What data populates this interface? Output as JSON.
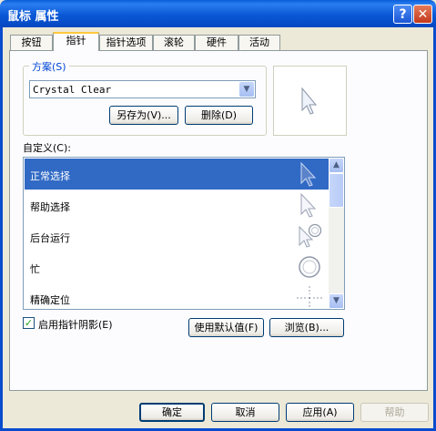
{
  "window": {
    "title": "鼠标 属性",
    "help": "?",
    "close": "✕"
  },
  "tabs": [
    {
      "label": "按钮"
    },
    {
      "label": "指针"
    },
    {
      "label": "指针选项"
    },
    {
      "label": "滚轮"
    },
    {
      "label": "硬件"
    },
    {
      "label": "活动"
    }
  ],
  "active_tab": "指针",
  "scheme": {
    "label": "方案(S)",
    "selected": "Crystal Clear",
    "save_as": "另存为(V)...",
    "delete": "删除(D)"
  },
  "customize": {
    "label": "自定义(C):",
    "items": [
      {
        "label": "正常选择",
        "icon": "normal-select-cursor",
        "selected": true
      },
      {
        "label": "帮助选择",
        "icon": "help-select-cursor",
        "selected": false
      },
      {
        "label": "后台运行",
        "icon": "working-in-background-cursor",
        "selected": false
      },
      {
        "label": "忙",
        "icon": "busy-cursor",
        "selected": false
      },
      {
        "label": "精确定位",
        "icon": "precision-select-cursor",
        "selected": false
      }
    ]
  },
  "shadow_checkbox": {
    "label": "启用指针阴影(E)",
    "checked": true
  },
  "use_default": "使用默认值(F)",
  "browse": "浏览(B)...",
  "footer": {
    "ok": "确定",
    "cancel": "取消",
    "apply": "应用(A)",
    "help": "帮助"
  },
  "colors": {
    "selection": "#316ac5",
    "titlebar": "#0a5fd8",
    "face": "#ece9d8"
  }
}
